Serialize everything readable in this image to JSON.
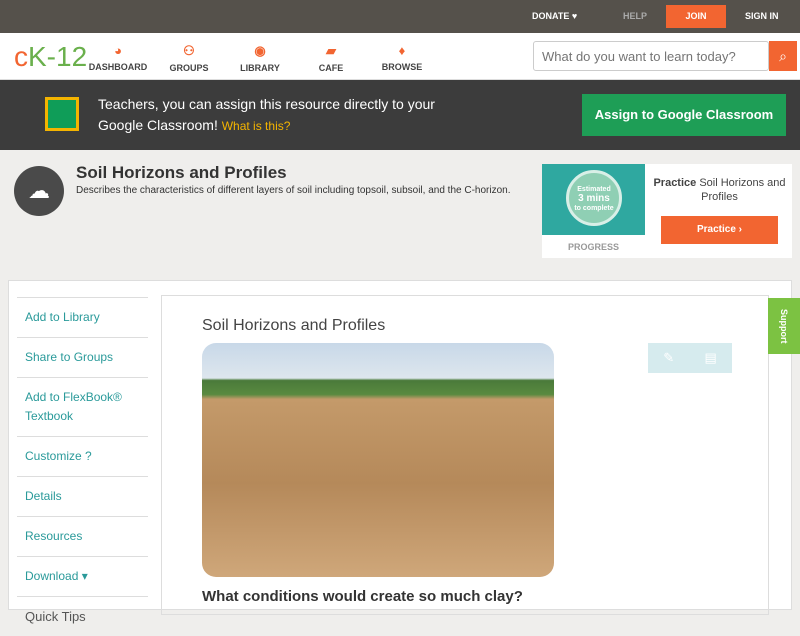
{
  "topbar": {
    "donate": "DONATE ♥",
    "help": "HELP",
    "join": "JOIN",
    "signin": "SIGN IN"
  },
  "nav": {
    "logo_a": "c",
    "logo_b": "K-12",
    "items": [
      {
        "icon": "◕",
        "label": "DASHBOARD"
      },
      {
        "icon": "⚇",
        "label": "GROUPS"
      },
      {
        "icon": "◉",
        "label": "LIBRARY"
      },
      {
        "icon": "▰",
        "label": "CAFE"
      },
      {
        "icon": "♦",
        "label": "BROWSE"
      }
    ],
    "search_placeholder": "What do you want to learn today?",
    "search_icon": "⌕"
  },
  "classroom": {
    "text": "Teachers, you can assign this resource directly to your Google Classroom!",
    "link": "What is this?",
    "button": "Assign to Google Classroom"
  },
  "header": {
    "icon": "☁",
    "title": "Soil Horizons and Profiles",
    "description": "Describes the characteristics of different layers of soil including topsoil, subsoil, and the C-horizon."
  },
  "practice": {
    "estimate_1": "Estimated",
    "estimate_2": "3 mins",
    "estimate_3": "to complete",
    "progress": "PROGRESS",
    "bold": "Practice",
    "title": "Soil Horizons and Profiles",
    "button": "Practice ›"
  },
  "sidebar": [
    "Add to Library",
    "Share to Groups",
    "Add to FlexBook® Textbook",
    "Customize ?",
    "Details",
    "Resources",
    "Download ▾"
  ],
  "quick_tips": "Quick Tips",
  "content": {
    "title": "Soil Horizons and Profiles",
    "question": "What conditions would create so much clay?",
    "tool_pen": "✎",
    "tool_notes": "▤"
  },
  "support": "Support"
}
